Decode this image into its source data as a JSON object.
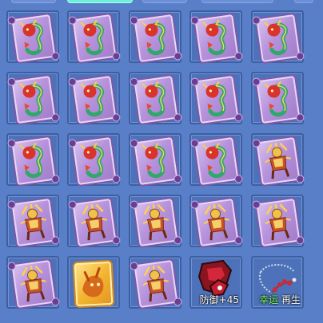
{
  "tabs": [
    "",
    "",
    "",
    "",
    ""
  ],
  "inventory": {
    "rows": [
      [
        "dragon-scroll",
        "dragon-scroll",
        "dragon-scroll",
        "dragon-scroll",
        "dragon-scroll"
      ],
      [
        "dragon-scroll",
        "dragon-scroll",
        "dragon-scroll",
        "dragon-scroll",
        "dragon-scroll"
      ],
      [
        "dragon-scroll",
        "dragon-scroll",
        "dragon-scroll",
        "dragon-scroll",
        "warrior-scroll"
      ],
      [
        "warrior-scroll",
        "warrior-scroll",
        "warrior-scroll",
        "warrior-scroll",
        "warrior-scroll"
      ],
      [
        "warrior-scroll",
        "golden-beast-card",
        "warrior-scroll",
        "red-armor",
        "bead-necklace"
      ]
    ],
    "armor_badge": "防御+45",
    "necklace_lucky": "幸运",
    "necklace_regen": "再生"
  },
  "colors": {
    "background": "#5a7fc9",
    "slot": "#4d72b9",
    "active_tab": "#6ff0d6",
    "lucky_text": "#7dff6a"
  }
}
